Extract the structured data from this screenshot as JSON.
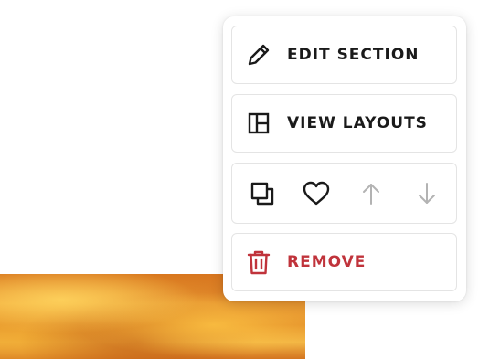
{
  "menu": {
    "edit_section": {
      "label": "EDIT SECTION",
      "icon": "pencil-icon"
    },
    "view_layouts": {
      "label": "VIEW LAYOUTS",
      "icon": "layout-icon"
    },
    "actions": [
      {
        "name": "duplicate",
        "icon": "duplicate-icon",
        "enabled": true
      },
      {
        "name": "favorite",
        "icon": "heart-icon",
        "enabled": true
      },
      {
        "name": "move-up",
        "icon": "arrow-up-icon",
        "enabled": false
      },
      {
        "name": "move-down",
        "icon": "arrow-down-icon",
        "enabled": false
      }
    ],
    "remove": {
      "label": "REMOVE",
      "icon": "trash-icon"
    }
  },
  "colors": {
    "text": "#1a1a1a",
    "danger": "#c0333b",
    "disabled": "#b3b3b3",
    "border": "#e4e4e4"
  }
}
